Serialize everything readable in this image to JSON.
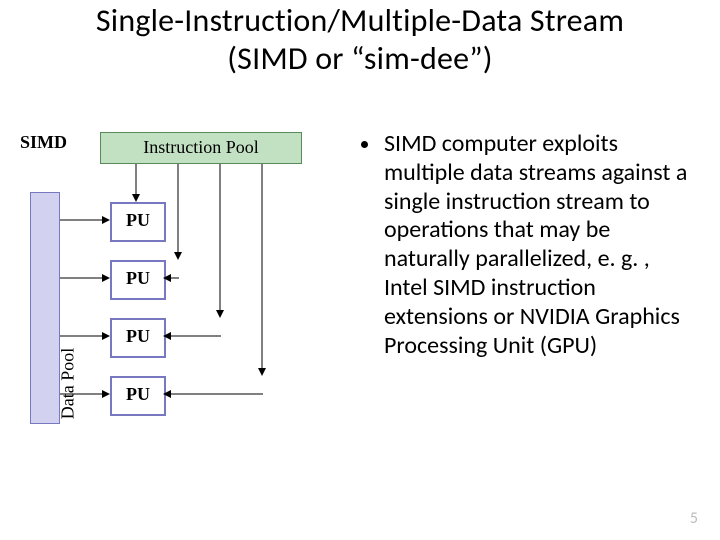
{
  "title_line1": "Single-Instruction/Multiple-Data Stream",
  "title_line2": "(SIMD or “sim-dee”)",
  "diagram": {
    "simd_label": "SIMD",
    "instruction_pool": "Instruction Pool",
    "data_pool": "Data Pool",
    "pu_label": "PU",
    "pu_count": 4,
    "colors": {
      "inst_pool_fill": "#c2e0c2",
      "inst_pool_border": "#5a8a5a",
      "data_pool_fill": "#d2d2f0",
      "data_pool_border": "#7878c0",
      "pu_border": "#7878c0"
    }
  },
  "bullet": "SIMD computer exploits multiple data streams against a single instruction stream to operations that may be naturally parallelized, e. g. , Intel SIMD instruction extensions or NVIDIA Graphics Processing Unit (GPU)",
  "page_number": "5"
}
